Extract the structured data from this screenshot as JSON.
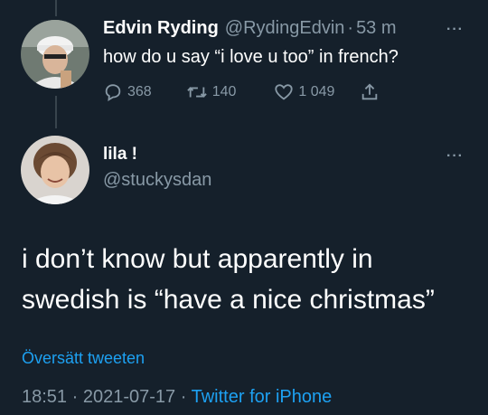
{
  "tweet1": {
    "name": "Edvin Ryding",
    "handle": "@RydingEdvin",
    "separator": "·",
    "time": "53 m",
    "text": "how do u say “i love u too” in french?",
    "replies": "368",
    "retweets": "140",
    "likes": "1 049",
    "more_label": "···"
  },
  "tweet2": {
    "name": "lila !",
    "handle": "@stuckysdan",
    "more_label": "···",
    "line1": "i don’t know but apparently in",
    "line2": "swedish is “have a nice christmas”",
    "translate_label": "Översätt tweeten",
    "time": "18:51",
    "separator": "·",
    "date": "2021-07-17",
    "source": "Twitter for iPhone"
  },
  "icons": {
    "reply": "reply-icon",
    "retweet": "retweet-icon",
    "like": "heart-icon",
    "share": "share-icon"
  },
  "colors": {
    "background": "#15202b",
    "text_primary": "#ffffff",
    "text_secondary": "#8899a6",
    "link": "#1da1f2"
  }
}
